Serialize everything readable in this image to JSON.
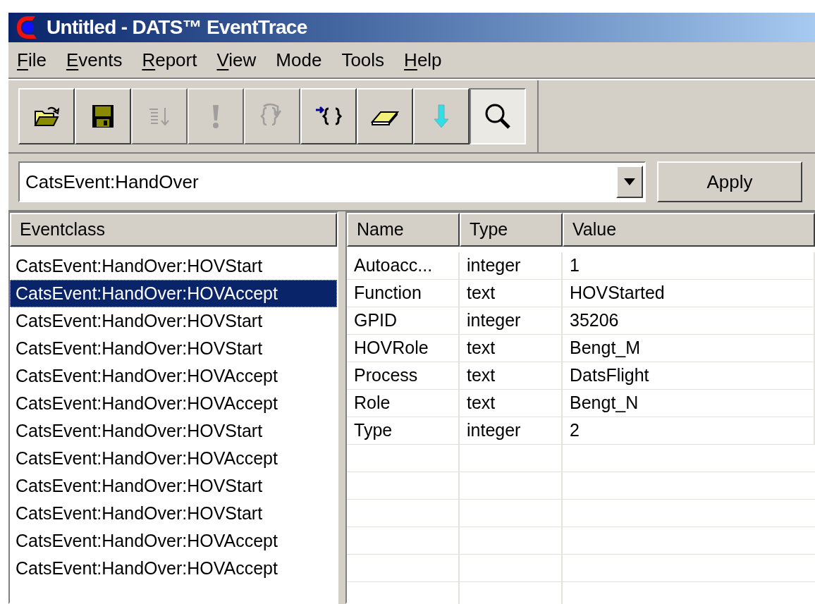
{
  "window": {
    "title": "Untitled - DATS™ EventTrace"
  },
  "menu": [
    {
      "label": "File",
      "underlined": true
    },
    {
      "label": "Events",
      "underlined": true
    },
    {
      "label": "Report",
      "underlined": true
    },
    {
      "label": "View",
      "underlined": true
    },
    {
      "label": "Mode",
      "underlined": false
    },
    {
      "label": "Tools",
      "underlined": false
    },
    {
      "label": "Help",
      "underlined": true
    }
  ],
  "toolbar": [
    {
      "kind": "open",
      "disabled": false,
      "pressed": false
    },
    {
      "kind": "save",
      "disabled": false,
      "pressed": false
    },
    {
      "kind": "sort",
      "disabled": true,
      "pressed": false
    },
    {
      "kind": "alert",
      "disabled": true,
      "pressed": false
    },
    {
      "kind": "step",
      "disabled": true,
      "pressed": false
    },
    {
      "kind": "insert",
      "disabled": false,
      "pressed": false
    },
    {
      "kind": "erase",
      "disabled": false,
      "pressed": false
    },
    {
      "kind": "down",
      "disabled": false,
      "pressed": false
    },
    {
      "kind": "find",
      "disabled": false,
      "pressed": true
    }
  ],
  "filter": {
    "value": "CatsEvent:HandOver",
    "button": "Apply"
  },
  "events": {
    "column": "Eventclass",
    "rows": [
      {
        "label": "CatsEvent:HandOver:HOVStart",
        "selected": false
      },
      {
        "label": "CatsEvent:HandOver:HOVAccept",
        "selected": true
      },
      {
        "label": "CatsEvent:HandOver:HOVStart",
        "selected": false
      },
      {
        "label": "CatsEvent:HandOver:HOVStart",
        "selected": false
      },
      {
        "label": "CatsEvent:HandOver:HOVAccept",
        "selected": false
      },
      {
        "label": "CatsEvent:HandOver:HOVAccept",
        "selected": false
      },
      {
        "label": "CatsEvent:HandOver:HOVStart",
        "selected": false
      },
      {
        "label": "CatsEvent:HandOver:HOVAccept",
        "selected": false
      },
      {
        "label": "CatsEvent:HandOver:HOVStart",
        "selected": false
      },
      {
        "label": "CatsEvent:HandOver:HOVStart",
        "selected": false
      },
      {
        "label": "CatsEvent:HandOver:HOVAccept",
        "selected": false
      },
      {
        "label": "CatsEvent:HandOver:HOVAccept",
        "selected": false
      }
    ]
  },
  "properties": {
    "columns": [
      "Name",
      "Type",
      "Value"
    ],
    "rows": [
      [
        "Autoacc...",
        "integer",
        "1"
      ],
      [
        "Function",
        "text",
        "HOVStarted"
      ],
      [
        "GPID",
        "integer",
        "35206"
      ],
      [
        "HOVRole",
        "text",
        "Bengt_M"
      ],
      [
        "Process",
        "text",
        "DatsFlight"
      ],
      [
        "Role",
        "text",
        "Bengt_N"
      ],
      [
        "Type",
        "integer",
        "2"
      ]
    ]
  }
}
